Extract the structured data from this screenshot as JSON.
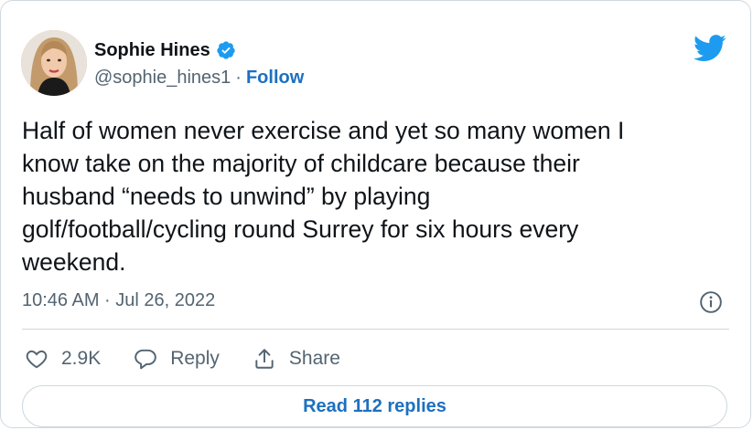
{
  "author": {
    "name": "Sophie Hines",
    "handle": "@sophie_hines1",
    "separator": "·",
    "follow_label": "Follow"
  },
  "icons": {
    "verified": "verified-badge-icon",
    "brand": "twitter-bird-icon",
    "info": "info-icon",
    "like": "heart-icon",
    "reply": "speech-bubble-icon",
    "share": "share-icon"
  },
  "tweet": {
    "text": "Half of women never exercise and yet so many women I\nknow take on the majority of childcare because their\nhusband “needs to unwind” by playing\ngolf/football/cycling round Surrey for six hours every\nweekend.",
    "timestamp": "10:46 AM · Jul 26, 2022"
  },
  "actions": {
    "like_count": "2.9K",
    "reply_label": "Reply",
    "share_label": "Share"
  },
  "read_replies_label": "Read 112 replies",
  "colors": {
    "accent": "#1d70c0",
    "twitter_blue": "#1d9bf0",
    "secondary_text": "#536471",
    "border": "#cfd9de"
  }
}
